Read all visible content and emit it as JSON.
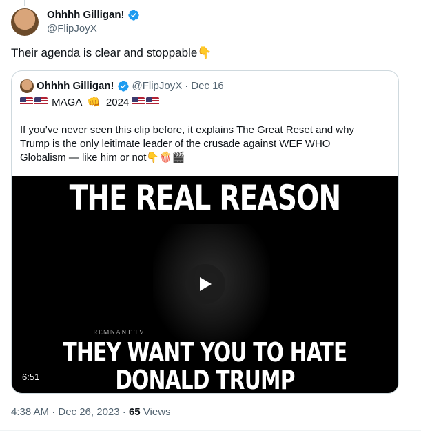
{
  "tweet": {
    "display_name": "Ohhhh Gilligan!",
    "handle": "@FlipJoyX",
    "text": "Their agenda is clear and stoppable",
    "text_emoji": "👇",
    "timestamp": "4:38 AM · Dec 26, 2023",
    "sep": " · ",
    "views_count": "65",
    "views_label": "Views"
  },
  "quote": {
    "display_name": "Ohhhh Gilligan!",
    "handle": "@FlipJoyX",
    "dot": "·",
    "date": "Dec 16",
    "bio_maga": "MAGA",
    "bio_fist": "👊",
    "bio_year": "2024",
    "text": "If you’ve never seen this clip before, it explains The Great Reset and why Trump is the only leitimate leader of the crusade against WEF WHO Globalism — like him or not",
    "text_emojis": "👇🍿🎬"
  },
  "video": {
    "title_top": "THE REAL REASON",
    "brand": "REMNANT TV",
    "title_bottom_1": "THEY WANT YOU TO HATE",
    "title_bottom_2": "DONALD TRUMP",
    "duration": "6:51"
  },
  "colors": {
    "verified": "#1d9bf0",
    "muted": "#536471",
    "border": "#cfd9de"
  },
  "icons": [
    "verified-badge-icon",
    "play-icon",
    "us-flag-icon"
  ]
}
